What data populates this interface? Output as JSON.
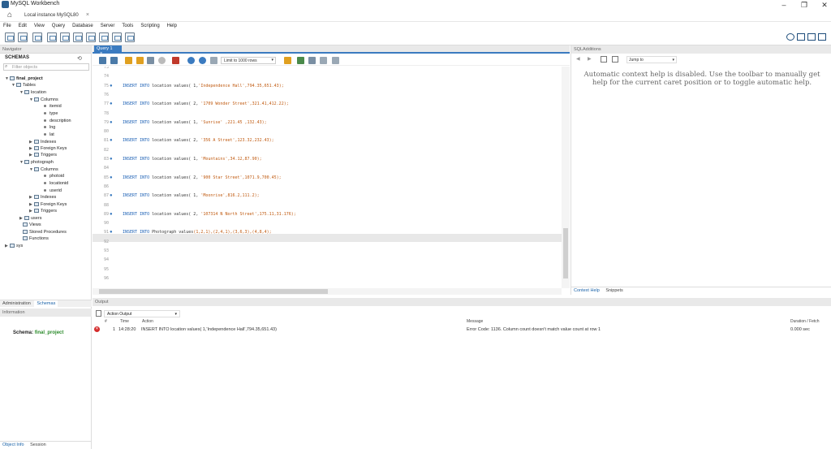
{
  "window": {
    "title": "MySQL Workbench",
    "minimize": "–",
    "maximize": "❐",
    "close": "✕"
  },
  "connection_tab": {
    "label": "Local instance MySQL80",
    "close": "×"
  },
  "menu": [
    "File",
    "Edit",
    "View",
    "Query",
    "Database",
    "Server",
    "Tools",
    "Scripting",
    "Help"
  ],
  "navigator": {
    "header": "Navigator",
    "schemas_label": "SCHEMAS",
    "filter_placeholder": "Filter objects",
    "tree": [
      {
        "label": "final_project",
        "bold": true
      },
      {
        "label": "Tables"
      },
      {
        "label": "location"
      },
      {
        "label": "Columns"
      },
      {
        "label": "itemid"
      },
      {
        "label": "type"
      },
      {
        "label": "description"
      },
      {
        "label": "lng"
      },
      {
        "label": "lat"
      },
      {
        "label": "Indexes"
      },
      {
        "label": "Foreign Keys"
      },
      {
        "label": "Triggers"
      },
      {
        "label": "photograph"
      },
      {
        "label": "Columns"
      },
      {
        "label": "photoid"
      },
      {
        "label": "locationid"
      },
      {
        "label": "userid"
      },
      {
        "label": "Indexes"
      },
      {
        "label": "Foreign Keys"
      },
      {
        "label": "Triggers"
      },
      {
        "label": "users"
      },
      {
        "label": "Views"
      },
      {
        "label": "Stored Procedures"
      },
      {
        "label": "Functions"
      },
      {
        "label": "sys"
      }
    ],
    "bottom_tabs": [
      "Administration",
      "Schemas"
    ],
    "information_header": "Information",
    "schema_info_label": "Schema:",
    "schema_info_value": "final_project",
    "footer_tabs": [
      "Object Info",
      "Session"
    ]
  },
  "query": {
    "tab_label": "Query 1",
    "tab_close": "×",
    "limit_label": "Limit to 1000 rows",
    "lines": [
      {
        "n": "73",
        "dot": false,
        "code": ""
      },
      {
        "n": "74",
        "dot": false,
        "code": ""
      },
      {
        "n": "75",
        "dot": true,
        "kw": "INSERT INTO",
        "rest": " location values( 1,",
        "str": "'Independence Hall'",
        "tail": ",794.35,651.43);"
      },
      {
        "n": "76",
        "dot": false,
        "code": ""
      },
      {
        "n": "77",
        "dot": true,
        "kw": "INSERT INTO",
        "rest": " location values( 2, ",
        "str": "'1709 Wonder Street'",
        "tail": ",321.41,412.22);"
      },
      {
        "n": "78",
        "dot": false,
        "code": ""
      },
      {
        "n": "79",
        "dot": true,
        "kw": "INSERT INTO",
        "rest": " location values( 1, ",
        "str": "'Sunrise'",
        "tail": " ,221.45 ,132.43);"
      },
      {
        "n": "80",
        "dot": false,
        "code": ""
      },
      {
        "n": "81",
        "dot": true,
        "kw": "INSERT INTO",
        "rest": " location values( 2, ",
        "str": "'356 A Street'",
        "tail": ",123.32,232.43);"
      },
      {
        "n": "82",
        "dot": false,
        "code": ""
      },
      {
        "n": "83",
        "dot": true,
        "kw": "INSERT INTO",
        "rest": " location values( 1, ",
        "str": "'Mountains'",
        "tail": ",34.12,87.90);"
      },
      {
        "n": "84",
        "dot": false,
        "code": ""
      },
      {
        "n": "85",
        "dot": true,
        "kw": "INSERT INTO",
        "rest": " location values( 2, ",
        "str": "'900 Star Street'",
        "tail": ",1071.9,700.45);"
      },
      {
        "n": "86",
        "dot": false,
        "code": ""
      },
      {
        "n": "87",
        "dot": true,
        "kw": "INSERT INTO",
        "rest": " location values( 1, ",
        "str": "'Moonrise'",
        "tail": ",816.2,111.2);"
      },
      {
        "n": "88",
        "dot": false,
        "code": ""
      },
      {
        "n": "89",
        "dot": true,
        "kw": "INSERT INTO",
        "rest": " location values( 2, ",
        "str": "'107314 N North Street'",
        "tail": ",175.11,31.176);"
      },
      {
        "n": "90",
        "dot": false,
        "code": ""
      },
      {
        "n": "91",
        "dot": true,
        "kw": "INSERT INTO",
        "rest": " Photograph values",
        "str": "",
        "tail": "(1,2,1),(2,4,1),(3,6,3),(4,8,4);"
      },
      {
        "n": "92",
        "dot": false,
        "code": ""
      },
      {
        "n": "93",
        "dot": false,
        "code": ""
      },
      {
        "n": "94",
        "dot": false,
        "code": ""
      },
      {
        "n": "95",
        "dot": false,
        "code": ""
      },
      {
        "n": "96",
        "dot": false,
        "code": ""
      }
    ]
  },
  "sql_additions": {
    "header": "SQLAdditions",
    "jump_label": "Jump to",
    "help_text": "Automatic context help is disabled. Use the toolbar to manually get help for the current caret position or to toggle automatic help.",
    "bottom_tabs": [
      "Context Help",
      "Snippets"
    ]
  },
  "output": {
    "header": "Output",
    "action_select": "Action Output",
    "columns": [
      "#",
      "Time",
      "Action",
      "Message",
      "Duration / Fetch"
    ],
    "row": {
      "num": "1",
      "time": "14:28:20",
      "action": "INSERT INTO location values( 1,'Independence Hall',794.35,651.43)",
      "message": "Error Code: 1136. Column count doesn't match value count at row 1",
      "duration": "0.000 sec"
    }
  },
  "colors": {
    "accent": "#3b7bc0",
    "error": "#d42b2b",
    "schema_green": "#2a8a2a"
  }
}
